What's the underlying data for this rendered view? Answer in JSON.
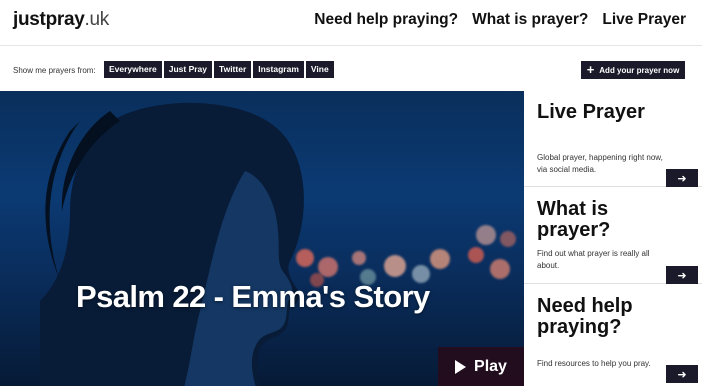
{
  "header": {
    "logo_brand": "justpray",
    "logo_tld": ".uk",
    "nav": [
      "Need help praying?",
      "What is prayer?",
      "Live Prayer"
    ]
  },
  "filters": {
    "label": "Show me prayers from:",
    "buttons": [
      "Everywhere",
      "Just Pray",
      "Twitter",
      "Instagram",
      "Vine"
    ],
    "add_prayer": "Add your prayer now"
  },
  "hero": {
    "title": "Psalm 22 - Emma's Story",
    "play_label": "Play"
  },
  "cards": [
    {
      "title": "Live Prayer",
      "text": "Global prayer, happening right now, via social media."
    },
    {
      "title": "What is prayer?",
      "text": "Find out what prayer is really all about."
    },
    {
      "title": "Need help praying?",
      "text": "Find resources to help you pray."
    }
  ],
  "colors": {
    "dark": "#1a1a2a",
    "hero_blue": "#0b3a73"
  },
  "icons": {
    "add": "plus-icon",
    "play": "play-icon",
    "card_arrow": "arrow-right-icon"
  }
}
